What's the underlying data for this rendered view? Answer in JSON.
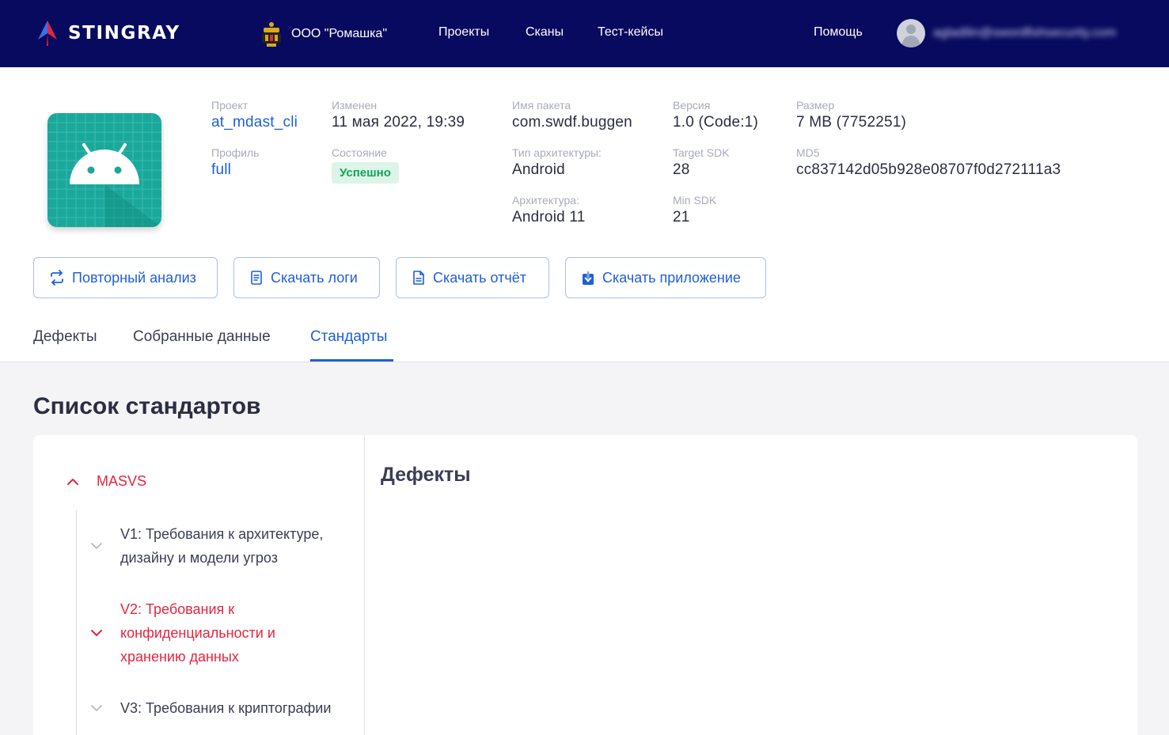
{
  "header": {
    "brand": "STINGRAY",
    "organization": "ООО \"Ромашка\"",
    "nav": [
      "Проекты",
      "Сканы",
      "Тест-кейсы"
    ],
    "help": "Помощь",
    "user_email": "agladilin@swordfishsecurity.com"
  },
  "scan": {
    "project_label": "Проект",
    "project": "at_mdast_cli",
    "profile_label": "Профиль",
    "profile": "full",
    "modified_label": "Изменен",
    "modified": "11 мая 2022, 19:39",
    "status_label": "Состояние",
    "status": "Успешно",
    "package_label": "Имя пакета",
    "package": "com.swdf.buggen",
    "arch_type_label": "Тип архитектуры:",
    "arch_type": "Android",
    "arch_label": "Архитектура:",
    "arch": "Android 11",
    "version_label": "Версия",
    "version": "1.0 (Code:1)",
    "target_sdk_label": "Target SDK",
    "target_sdk": "28",
    "min_sdk_label": "Min SDK",
    "min_sdk": "21",
    "size_label": "Размер",
    "size": "7 MB (7752251)",
    "md5_label": "MD5",
    "md5": "cc837142d05b928e08707f0d272111a3"
  },
  "actions": [
    "Повторный анализ",
    "Скачать логи",
    "Скачать отчёт",
    "Скачать приложение"
  ],
  "tabs": [
    "Дефекты",
    "Собранные данные",
    "Стандарты"
  ],
  "active_tab": "Стандарты",
  "standards": {
    "title": "Список стандартов",
    "group": "MASVS",
    "items": [
      {
        "lines": [
          "V1: Требования к архитектуре,",
          "дизайну и модели угроз"
        ]
      },
      {
        "lines": [
          "V2: Требования к",
          "конфиденциальности и",
          "хранению данных"
        ]
      },
      {
        "lines": [
          "V3: Требования к криптографии"
        ]
      }
    ],
    "panel_title": "Дефекты"
  },
  "colors": {
    "nav_bg": "#070a5e",
    "accent_blue": "#1e5fd8",
    "accent_red": "#e32640",
    "success_bg": "#dcf5e8",
    "success_text": "#17a35a",
    "app_icon_bg": "#1aa89a"
  },
  "icons": [
    "stingray-logo",
    "org-emblem-icon",
    "user-avatar-icon",
    "android-app-icon",
    "refresh-icon",
    "log-file-icon",
    "report-file-icon",
    "download-app-icon",
    "chevron-up-icon",
    "chevron-down-icon"
  ]
}
